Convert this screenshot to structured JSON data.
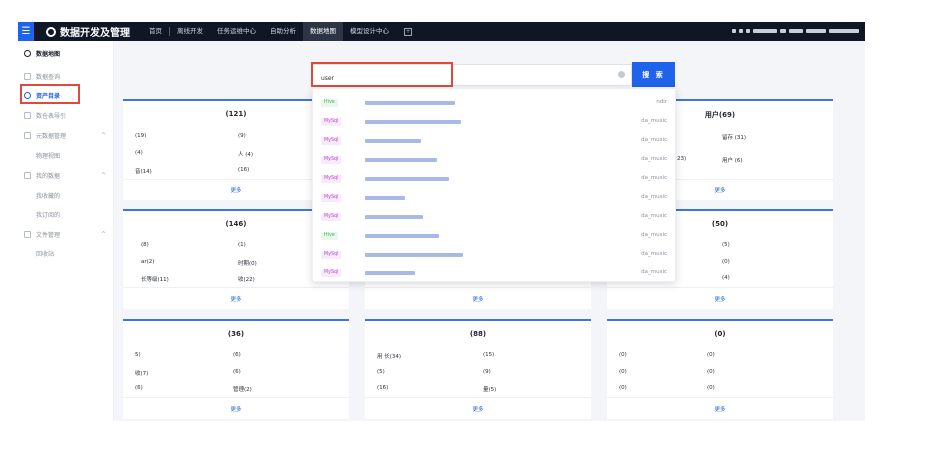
{
  "topbar": {
    "app_title": "数据开发及管理",
    "nav": [
      "首页",
      "离线开发",
      "任务运维中心",
      "自助分析",
      "数据地图",
      "模型设计中心"
    ],
    "active_nav": "数据地图"
  },
  "sidebar": {
    "title": "数据地图",
    "items": [
      {
        "label": "数据查询",
        "type": "item"
      },
      {
        "label": "资产目录",
        "type": "selected"
      },
      {
        "label": "数仓表导引",
        "type": "item"
      },
      {
        "label": "元数据管理",
        "type": "group"
      },
      {
        "label": "物理视图",
        "type": "sub"
      },
      {
        "label": "我的数据",
        "type": "group"
      },
      {
        "label": "我收藏的",
        "type": "sub"
      },
      {
        "label": "我订阅的",
        "type": "sub"
      },
      {
        "label": "文件管理",
        "type": "group"
      },
      {
        "label": "回收站",
        "type": "sub"
      }
    ]
  },
  "search": {
    "value": "user",
    "button_label": "搜 索"
  },
  "dropdown": {
    "results": [
      {
        "engine": "Hive",
        "db": "ndir"
      },
      {
        "engine": "MySql",
        "db": "da_music"
      },
      {
        "engine": "MySql",
        "db": "da_music"
      },
      {
        "engine": "MySql",
        "db": "da_music"
      },
      {
        "engine": "MySql",
        "db": "da_music"
      },
      {
        "engine": "MySql",
        "db": "da_music"
      },
      {
        "engine": "MySql",
        "db": "da_music"
      },
      {
        "engine": "Hive",
        "db": "da_music"
      },
      {
        "engine": "MySql",
        "db": "da_music"
      },
      {
        "engine": "MySql",
        "db": "da_music"
      }
    ]
  },
  "cards": {
    "more_label": "更多",
    "c1": {
      "title": "(121)",
      "rows": [
        "(19)",
        "(9)",
        "(4)",
        "人 (4)",
        "音(14)",
        "(16)"
      ]
    },
    "c3": {
      "title": "用户(69)",
      "rows": [
        "留存 (31)",
        "23)",
        "用户 (6)"
      ]
    },
    "c4": {
      "title": "(146)",
      "rows": [
        "(8)",
        "(1)",
        "ar(2)",
        "时期(0)",
        "长等级(11)",
        "收(22)"
      ]
    },
    "c6": {
      "title": "(50)",
      "rows": [
        "(5)",
        "(0)",
        "(4)"
      ]
    },
    "c7": {
      "title": "(36)",
      "rows": [
        "5)",
        "(6)",
        "收(7)",
        "(6)",
        "(6)",
        "管理(2)"
      ]
    },
    "c8": {
      "title": "(88)",
      "rows": [
        "用 长(34)",
        "(15)",
        "(5)",
        "(9)",
        "(16)",
        "量(5)"
      ]
    },
    "c9": {
      "title": "(0)",
      "rows": [
        "(0)",
        "(0)",
        "(0)",
        "(0)",
        "(0)",
        "(0)"
      ]
    }
  }
}
